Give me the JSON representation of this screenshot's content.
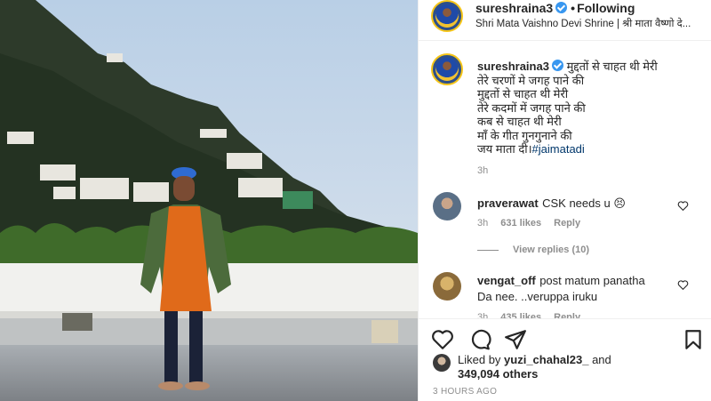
{
  "post": {
    "author": "sureshraina3",
    "follow_status": "Following",
    "location": "Shri Mata Vaishno Devi Shrine | श्री माता वैष्णो दे..."
  },
  "caption": {
    "user": "sureshraina3",
    "lines": [
      "मुद्दतों से चाहत थी मेरी",
      "तेरे चरणों मे जगह पाने की",
      "मुद्दतों से चाहत थी मेरी",
      "तेरे कदमों में जगह पाने की",
      "कब से चाहत थी मेरी",
      "माँ के गीत गुनगुनाने की",
      "जय माता दी।"
    ],
    "hashtag": "#jaimatadi",
    "time": "3h"
  },
  "comments": [
    {
      "user": "praverawat",
      "text": "CSK needs u 😣",
      "time": "3h",
      "likes": "631 likes",
      "reply": "Reply",
      "view_replies": "View replies (10)"
    },
    {
      "user": "vengat_off",
      "text_line1": "post matum panatha",
      "text_line2": "Da nee. ..veruppa iruku",
      "time": "3h",
      "likes": "435 likes",
      "reply": "Reply"
    }
  ],
  "likes": {
    "prefix": "Liked by",
    "user": "yuzi_chahal23_",
    "conj": "and",
    "others": "349,094 others"
  },
  "posted_ago": "3 HOURS AGO",
  "colors": {
    "verified": "#3897f0",
    "hashtag": "#00376b",
    "muted": "#8e8e8e",
    "text": "#262626"
  }
}
